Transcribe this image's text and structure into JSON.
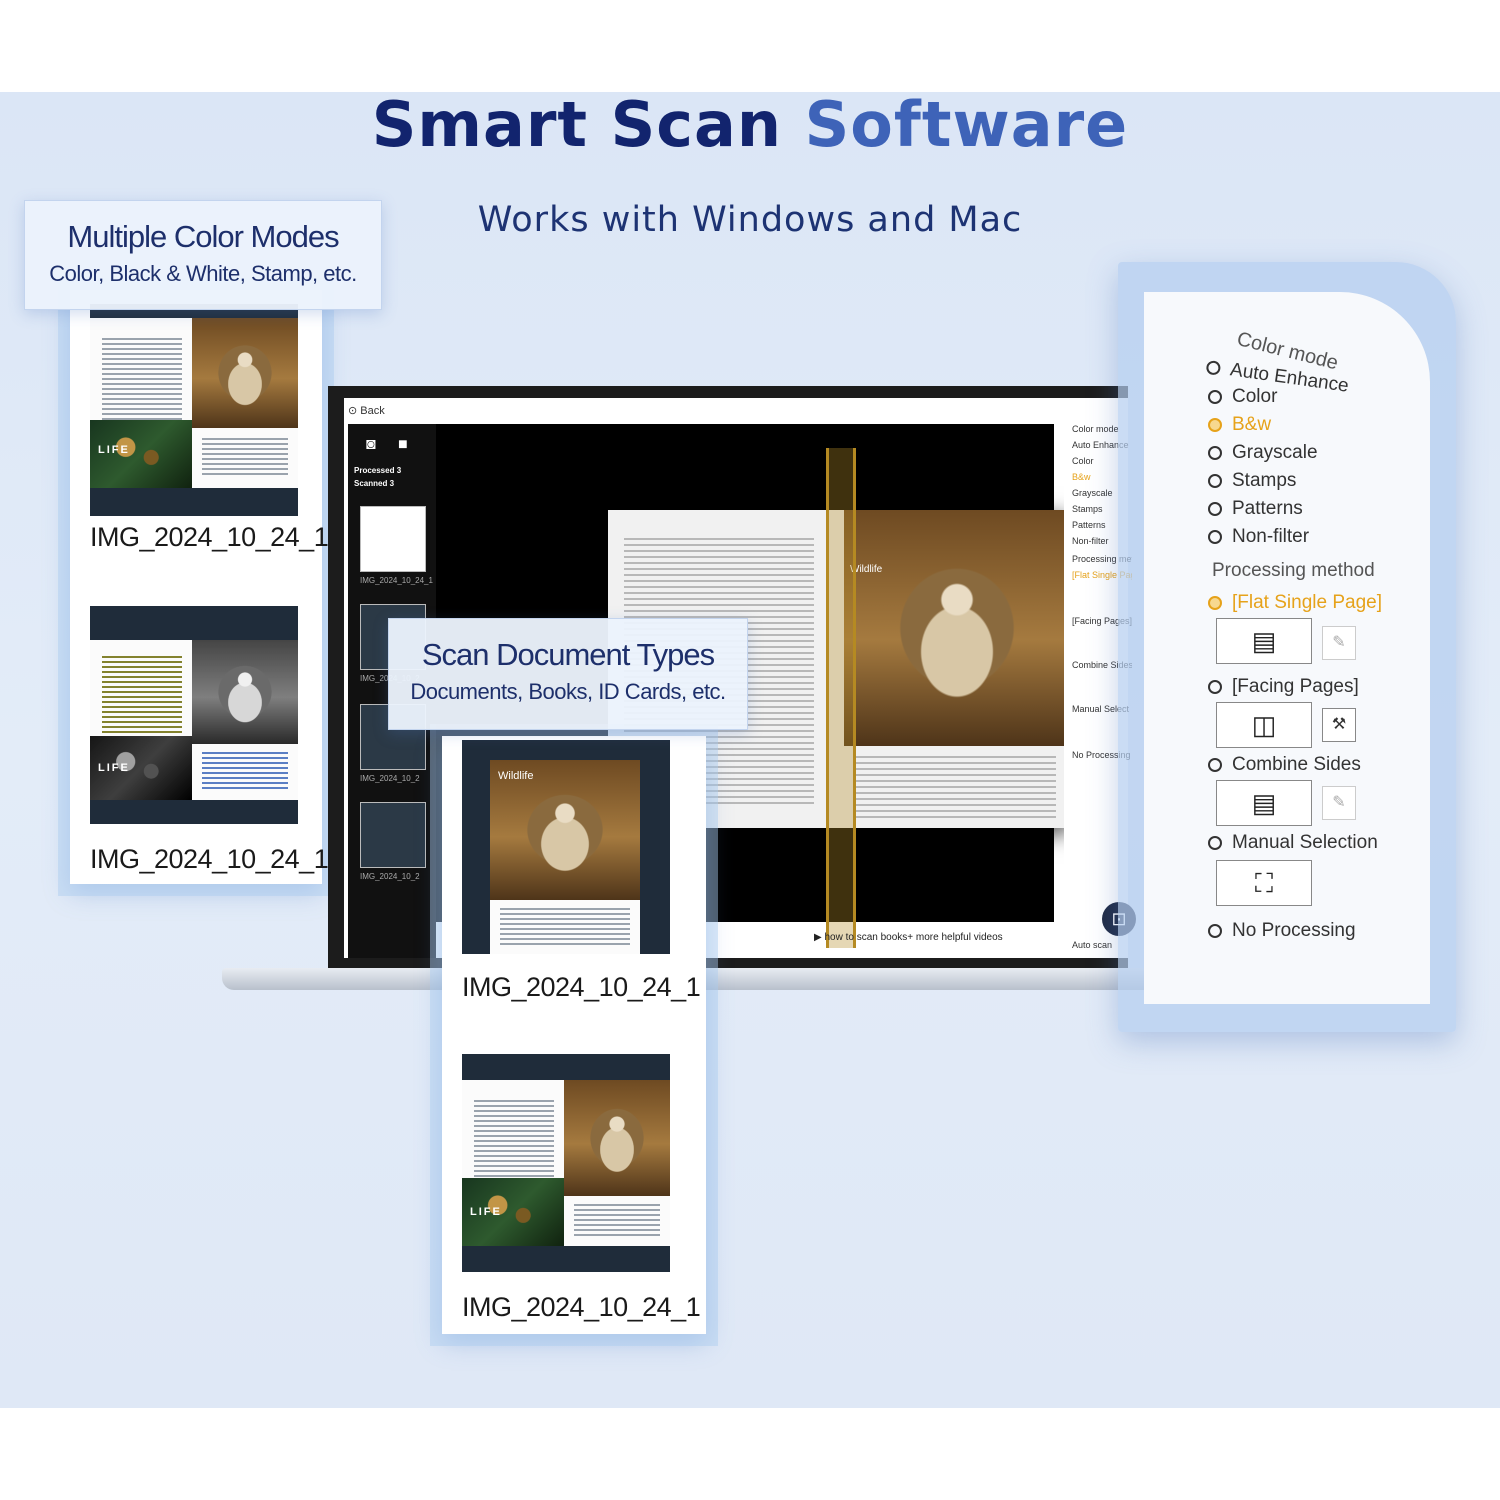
{
  "header": {
    "title_main": "Smart Scan",
    "title_accent": "Software",
    "subtitle": "Works with Windows and Mac"
  },
  "features": [
    {
      "heading": "Multiple Color Modes",
      "sub": "Color, Black & White, Stamp, etc."
    },
    {
      "heading": "Scan Document Types",
      "sub": "Documents, Books, ID Cards, etc."
    }
  ],
  "thumbnails": {
    "left": [
      {
        "label": "IMG_2024_10_24_1",
        "mode": "color"
      },
      {
        "label": "IMG_2024_10_24_1",
        "mode": "grayscale"
      }
    ],
    "middle": [
      {
        "label": "IMG_2024_10_24_1",
        "mode": "owl-page"
      },
      {
        "label": "IMG_2024_10_24_1",
        "mode": "spread"
      }
    ],
    "life_text": "LIFE",
    "wildlife_text": "Wildlife"
  },
  "app": {
    "back_label": "Back",
    "processed_label": "Processed  3",
    "scanned_label": "Scanned   3",
    "side_thumb_labels": [
      "IMG_2024_10_24_1",
      "IMG_2024_10_2",
      "IMG_2024_10_2",
      "IMG_2024_10_2"
    ],
    "footer_link": "how to scan books+ more helpful videos",
    "auto_scan": "Auto scan",
    "right_options": [
      "Color mode",
      "Auto Enhance",
      "Color",
      "B&w",
      "Grayscale",
      "Stamps",
      "Patterns",
      "Non-filter",
      "Processing meth",
      "[Flat Single Page]",
      "[Facing Pages]",
      "Combine Sides",
      "Manual Select",
      "No Processing"
    ]
  },
  "panel": {
    "color_mode_heading": "Color mode",
    "color_options": [
      {
        "label": "Auto Enhance",
        "selected": false
      },
      {
        "label": "Color",
        "selected": false
      },
      {
        "label": "B&w",
        "selected": true
      },
      {
        "label": "Grayscale",
        "selected": false
      },
      {
        "label": "Stamps",
        "selected": false
      },
      {
        "label": "Patterns",
        "selected": false
      },
      {
        "label": "Non-filter",
        "selected": false
      }
    ],
    "processing_heading": "Processing method",
    "processing_options": [
      {
        "label": "[Flat Single Page]",
        "selected": true
      },
      {
        "label": "[Facing Pages]",
        "selected": false
      },
      {
        "label": "Combine Sides",
        "selected": false
      },
      {
        "label": "Manual Selection",
        "selected": false
      },
      {
        "label": "No Processing",
        "selected": false
      }
    ]
  },
  "colors": {
    "title_dark": "#12246e",
    "title_accent": "#3e63b8",
    "selected": "#e6a21a"
  }
}
